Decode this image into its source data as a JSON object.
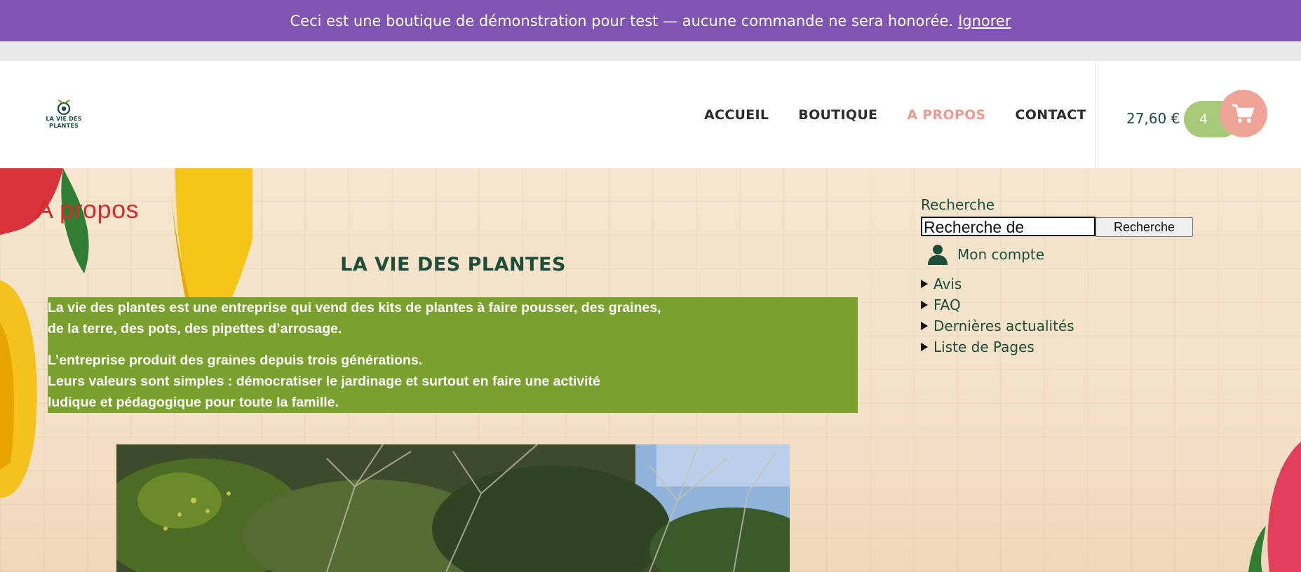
{
  "banner": {
    "text": "Ceci est une boutique de démonstration pour test — aucune commande ne sera honorée.",
    "dismiss_label": "Ignorer"
  },
  "header": {
    "logo_text_line1": "LA VIE DES",
    "logo_text_line2": "PLANTES",
    "nav": [
      {
        "label": "ACCUEIL",
        "active": false
      },
      {
        "label": "BOUTIQUE",
        "active": false
      },
      {
        "label": "A PROPOS",
        "active": true
      },
      {
        "label": "CONTACT",
        "active": false
      }
    ],
    "cart_total": "27,60 €",
    "cart_count": "4",
    "cart_icon": "shopping-cart-icon"
  },
  "main": {
    "page_title": "A propos",
    "heading": "LA VIE DES PLANTES",
    "paragraphs": [
      [
        "La vie des plantes est une entreprise qui vend des kits de plantes à faire pousser, des graines,",
        "de la terre, des pots, des pipettes d’arrosage."
      ],
      [
        "L’entreprise produit des graines depuis trois générations.",
        "Leurs valeurs sont simples : démocratiser le jardinage et surtout en faire une activité",
        "ludique et pédagogique pour toute la famille."
      ]
    ]
  },
  "sidebar": {
    "search_label": "Recherche",
    "search_placeholder": "Recherche de produits…",
    "search_button": "Recherche",
    "account_label": "Mon compte",
    "account_icon": "user-icon",
    "widgets": [
      "Avis",
      "FAQ",
      "Dernières actualités",
      "Liste de Pages"
    ]
  },
  "colors": {
    "banner": "#7f54b3",
    "brand_green": "#1e4d3a",
    "active_nav": "#ee9a8e",
    "intro_bg": "#7aa12e",
    "title_red": "#d32e2a",
    "cart_count_bg": "#a8c97a",
    "cart_button_bg": "#eea597"
  }
}
